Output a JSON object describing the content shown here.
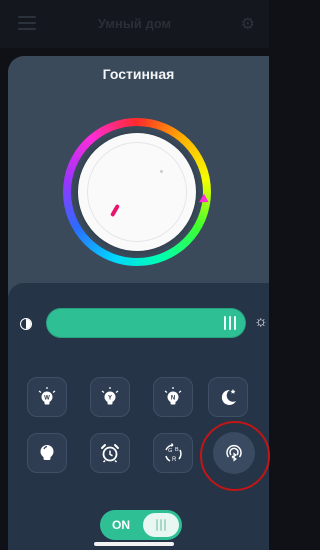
{
  "header": {
    "title": "Умный дом"
  },
  "sheet": {
    "title": "Гостинная"
  },
  "color_wheel": {
    "selected_hue_color": "#ff2cd9",
    "indicator_color": "#e6166e"
  },
  "brightness": {
    "min_icon": "brightness-low-icon",
    "max_icon": "brightness-high-icon",
    "level": 1.0
  },
  "mode_buttons": [
    {
      "name": "warm-white-bulb",
      "letter": "W"
    },
    {
      "name": "yellow-bulb",
      "letter": "Y"
    },
    {
      "name": "neutral-bulb",
      "letter": "N"
    },
    {
      "name": "night-mode",
      "icon": "moon-stars-icon"
    },
    {
      "name": "lamp",
      "icon": "lamp-icon"
    },
    {
      "name": "alarm",
      "icon": "alarm-clock-icon"
    },
    {
      "name": "rgb-cycle",
      "letters": [
        "G",
        "B",
        "R"
      ]
    },
    {
      "name": "bluetooth-sound",
      "icon": "bluetooth-audio-icon"
    }
  ],
  "power": {
    "label": "ON",
    "state": "on"
  },
  "colors": {
    "accent": "#2fbf95",
    "sheet_bg": "#3a4a5b",
    "controls_bg": "#263447",
    "highlight": "#c21616"
  }
}
